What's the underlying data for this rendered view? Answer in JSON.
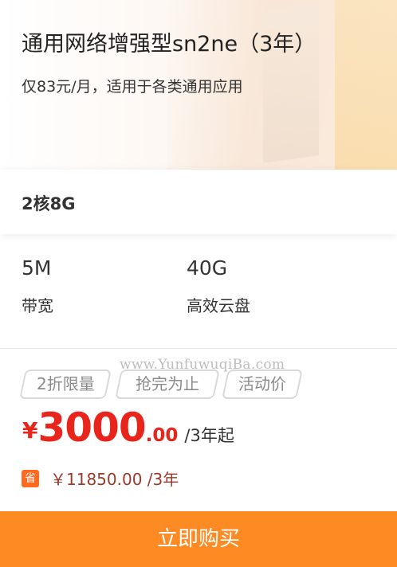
{
  "product": {
    "title": "通用网络增强型sn2ne（3年）",
    "subtitle": "仅83元/月，适用于各类通用应用"
  },
  "spec": {
    "cpu_mem": "2核8G"
  },
  "stats": [
    {
      "value": "5M",
      "label": "带宽"
    },
    {
      "value": "40G",
      "label": "高效云盘"
    }
  ],
  "watermark": "www.YunfuwuqiBa.com",
  "tags": [
    "2折限量",
    "抢完为止",
    "活动价"
  ],
  "price": {
    "currency": "¥",
    "integer": "3000",
    "decimal": ".00",
    "unit": "/3年起"
  },
  "original": {
    "badge": "省",
    "text": "￥11850.00 /3年"
  },
  "buy_button": "立即购买",
  "colors": {
    "accent_red": "#e8251c",
    "buy_orange": "#fd8a22",
    "badge_orange": "#ff6a1f"
  }
}
